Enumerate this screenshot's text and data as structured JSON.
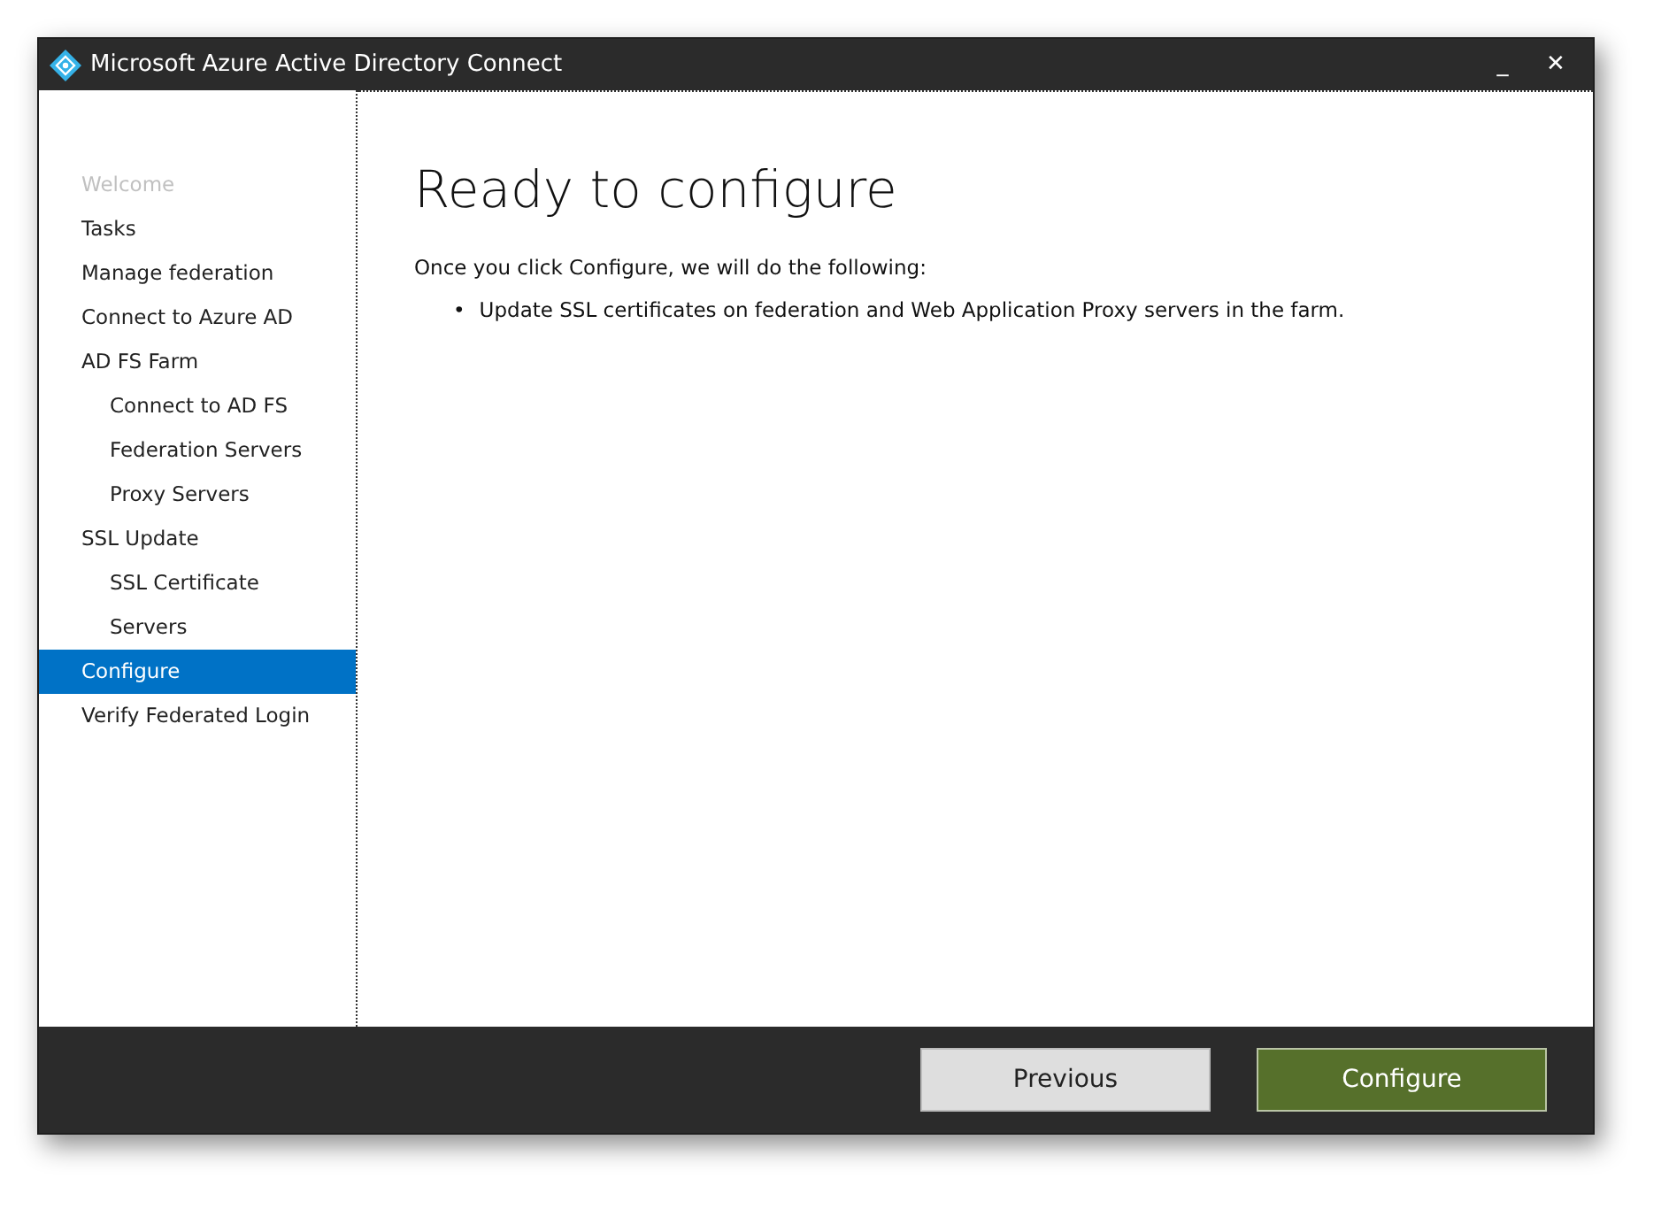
{
  "window": {
    "title": "Microsoft Azure Active Directory Connect",
    "controls": [
      {
        "kind": "minimize",
        "glyph": "_"
      },
      {
        "kind": "close",
        "glyph": "✕"
      }
    ]
  },
  "sidebar": {
    "items": [
      {
        "label": "Welcome",
        "disabled": true,
        "selected": false
      },
      {
        "label": "Tasks",
        "disabled": false,
        "selected": false
      },
      {
        "label": "Manage federation",
        "disabled": false,
        "selected": false
      },
      {
        "label": "Connect to Azure AD",
        "disabled": false,
        "selected": false
      },
      {
        "label": "AD FS Farm",
        "disabled": false,
        "selected": false,
        "children": [
          {
            "label": "Connect to AD FS",
            "disabled": false,
            "selected": false
          },
          {
            "label": "Federation Servers",
            "disabled": false,
            "selected": false
          },
          {
            "label": "Proxy Servers",
            "disabled": false,
            "selected": false
          }
        ]
      },
      {
        "label": "SSL Update",
        "disabled": false,
        "selected": false,
        "children": [
          {
            "label": "SSL Certificate",
            "disabled": false,
            "selected": false
          },
          {
            "label": "Servers",
            "disabled": false,
            "selected": false
          }
        ]
      },
      {
        "label": "Configure",
        "disabled": false,
        "selected": true
      },
      {
        "label": "Verify Federated Login",
        "disabled": false,
        "selected": false
      }
    ]
  },
  "content": {
    "heading": "Ready to configure",
    "intro": "Once you click Configure, we will do the following:",
    "bullets": [
      {
        "marker": "•",
        "text": "Update SSL certificates on federation and Web Application Proxy servers in the farm."
      }
    ]
  },
  "buttons": [
    {
      "label": "Previous",
      "kind": "secondary"
    },
    {
      "label": "Configure",
      "kind": "primary"
    }
  ]
}
